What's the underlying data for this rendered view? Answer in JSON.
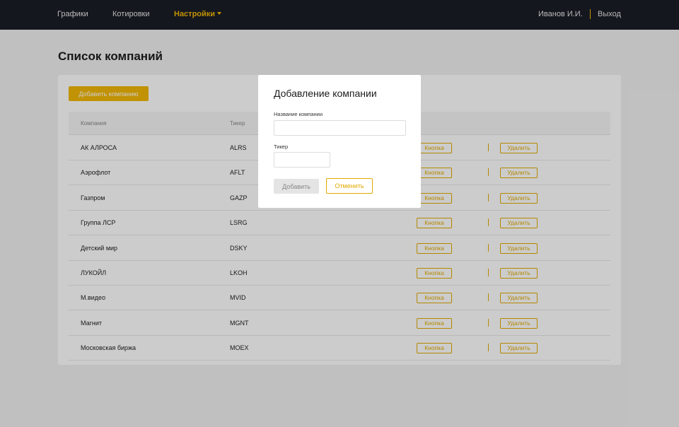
{
  "nav": {
    "items": [
      "Графики",
      "Котировки",
      "Настройки"
    ],
    "user_name": "Иванов И.И.",
    "logout": "Выход"
  },
  "page": {
    "title": "Список компаний"
  },
  "toolbar": {
    "add_company_label": "Добавить компанию"
  },
  "table": {
    "headers": [
      "Компания",
      "Тикер"
    ],
    "action_label": "Кнопка",
    "delete_label": "Удалить",
    "rows": [
      {
        "company": "АК АЛРОСА",
        "ticker": "ALRS"
      },
      {
        "company": "Аэрофлот",
        "ticker": "AFLT"
      },
      {
        "company": "Газпром",
        "ticker": "GAZP"
      },
      {
        "company": "Группа ЛСР",
        "ticker": "LSRG"
      },
      {
        "company": "Детский мир",
        "ticker": "DSKY"
      },
      {
        "company": "ЛУКОЙЛ",
        "ticker": "LKOH"
      },
      {
        "company": "М.видео",
        "ticker": "MVID"
      },
      {
        "company": "Магнит",
        "ticker": "MGNT"
      },
      {
        "company": "Московская биржа",
        "ticker": "MOEX"
      }
    ]
  },
  "modal": {
    "title": "Добавление компании",
    "name_label": "Название компании",
    "name_value": "",
    "ticker_label": "Тикер",
    "ticker_value": "",
    "add_label": "Добавить",
    "cancel_label": "Отменить"
  },
  "colors": {
    "accent": "#f2b705",
    "topbar": "#1a1d26"
  }
}
